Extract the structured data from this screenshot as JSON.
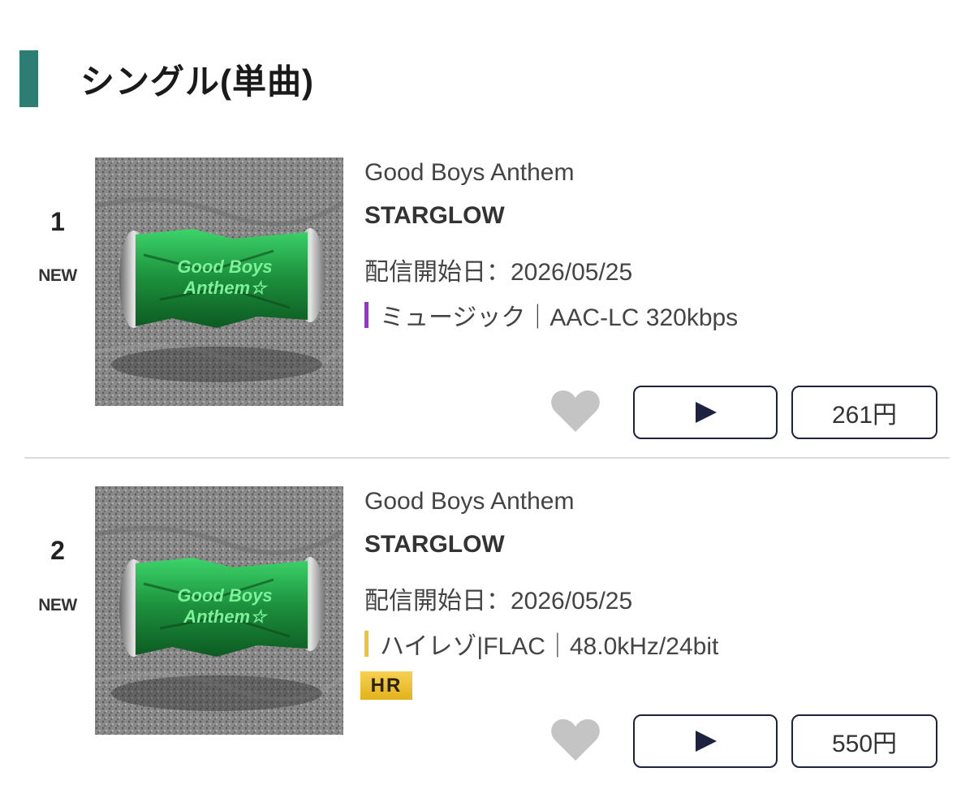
{
  "section": {
    "title": "シングル(単曲)",
    "accent_color": "#2e7d72"
  },
  "tracks": [
    {
      "rank": "1",
      "badge": "NEW",
      "title": "Good Boys Anthem",
      "artist": "STARGLOW",
      "release_label": "配信開始日：",
      "release_date": "2026/05/25",
      "format": "ミュージック｜AAC-LC 320kbps",
      "format_color": "#9b30d9",
      "hires_badge": "",
      "play_icon": "play-icon",
      "favorite_icon": "heart-icon",
      "price": "261円"
    },
    {
      "rank": "2",
      "badge": "NEW",
      "title": "Good Boys Anthem",
      "artist": "STARGLOW",
      "release_label": "配信開始日：",
      "release_date": "2026/05/25",
      "format": "ハイレゾ|FLAC｜48.0kHz/24bit",
      "format_color": "#f2c230",
      "hires_badge": "HR",
      "play_icon": "play-icon",
      "favorite_icon": "heart-icon",
      "price": "550円"
    }
  ],
  "cover_art": {
    "text_line1": "Good Boys",
    "text_line2": "Anthem☆"
  }
}
